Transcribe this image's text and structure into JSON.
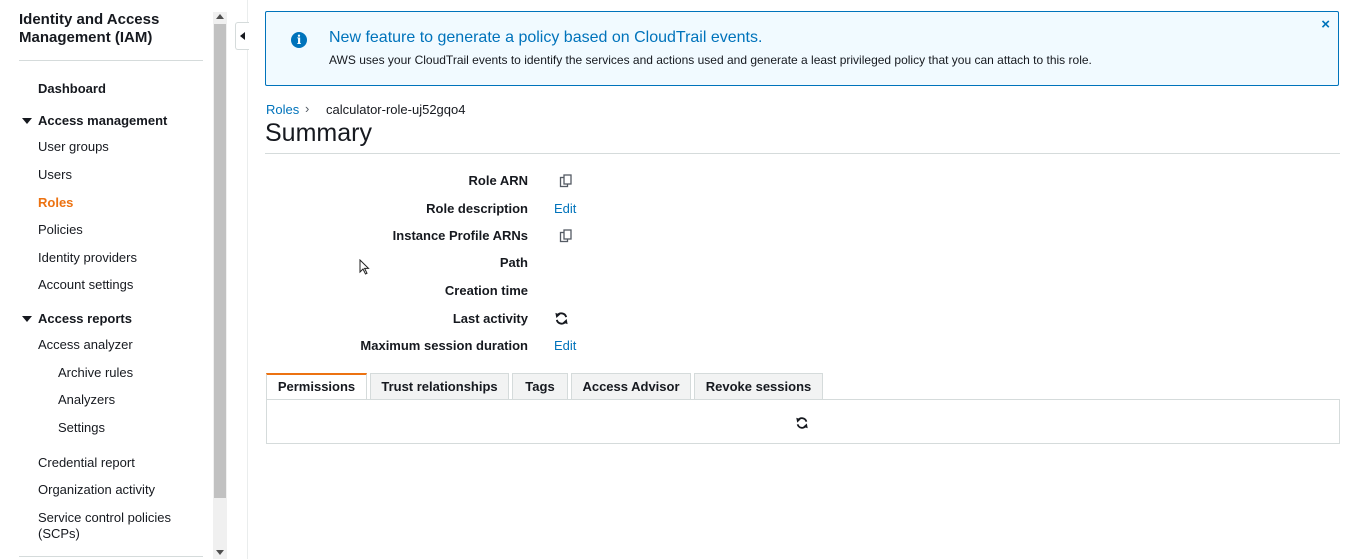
{
  "sidebar": {
    "title": "Identity and Access Management (IAM)",
    "dashboard": "Dashboard",
    "access_management": {
      "label": "Access management",
      "items": [
        "User groups",
        "Users",
        "Roles",
        "Policies",
        "Identity providers",
        "Account settings"
      ]
    },
    "access_reports": {
      "label": "Access reports",
      "items": [
        "Access analyzer",
        "Archive rules",
        "Analyzers",
        "Settings",
        "Credential report",
        "Organization activity",
        "Service control policies (SCPs)"
      ]
    }
  },
  "banner": {
    "title": "New feature to generate a policy based on CloudTrail events.",
    "text": "AWS uses your CloudTrail events to identify the services and actions used and generate a least privileged policy that you can attach to this role.",
    "close_label": "×",
    "info_label": "i"
  },
  "breadcrumb": {
    "parent": "Roles",
    "separator": "›",
    "current": "calculator-role-uj52gqo4"
  },
  "page_title": "Summary",
  "summary_fields": {
    "role_arn": "Role ARN",
    "role_description": "Role description",
    "instance_profile_arns": "Instance Profile ARNs",
    "path": "Path",
    "creation_time": "Creation time",
    "last_activity": "Last activity",
    "max_session_duration": "Maximum session duration",
    "edit_label": "Edit"
  },
  "tabs": [
    "Permissions",
    "Trust relationships",
    "Tags",
    "Access Advisor",
    "Revoke sessions"
  ],
  "active_tab": "Permissions",
  "colors": {
    "link": "#0073bb",
    "active_nav": "#ec7211",
    "banner_bg": "#f1faff"
  }
}
